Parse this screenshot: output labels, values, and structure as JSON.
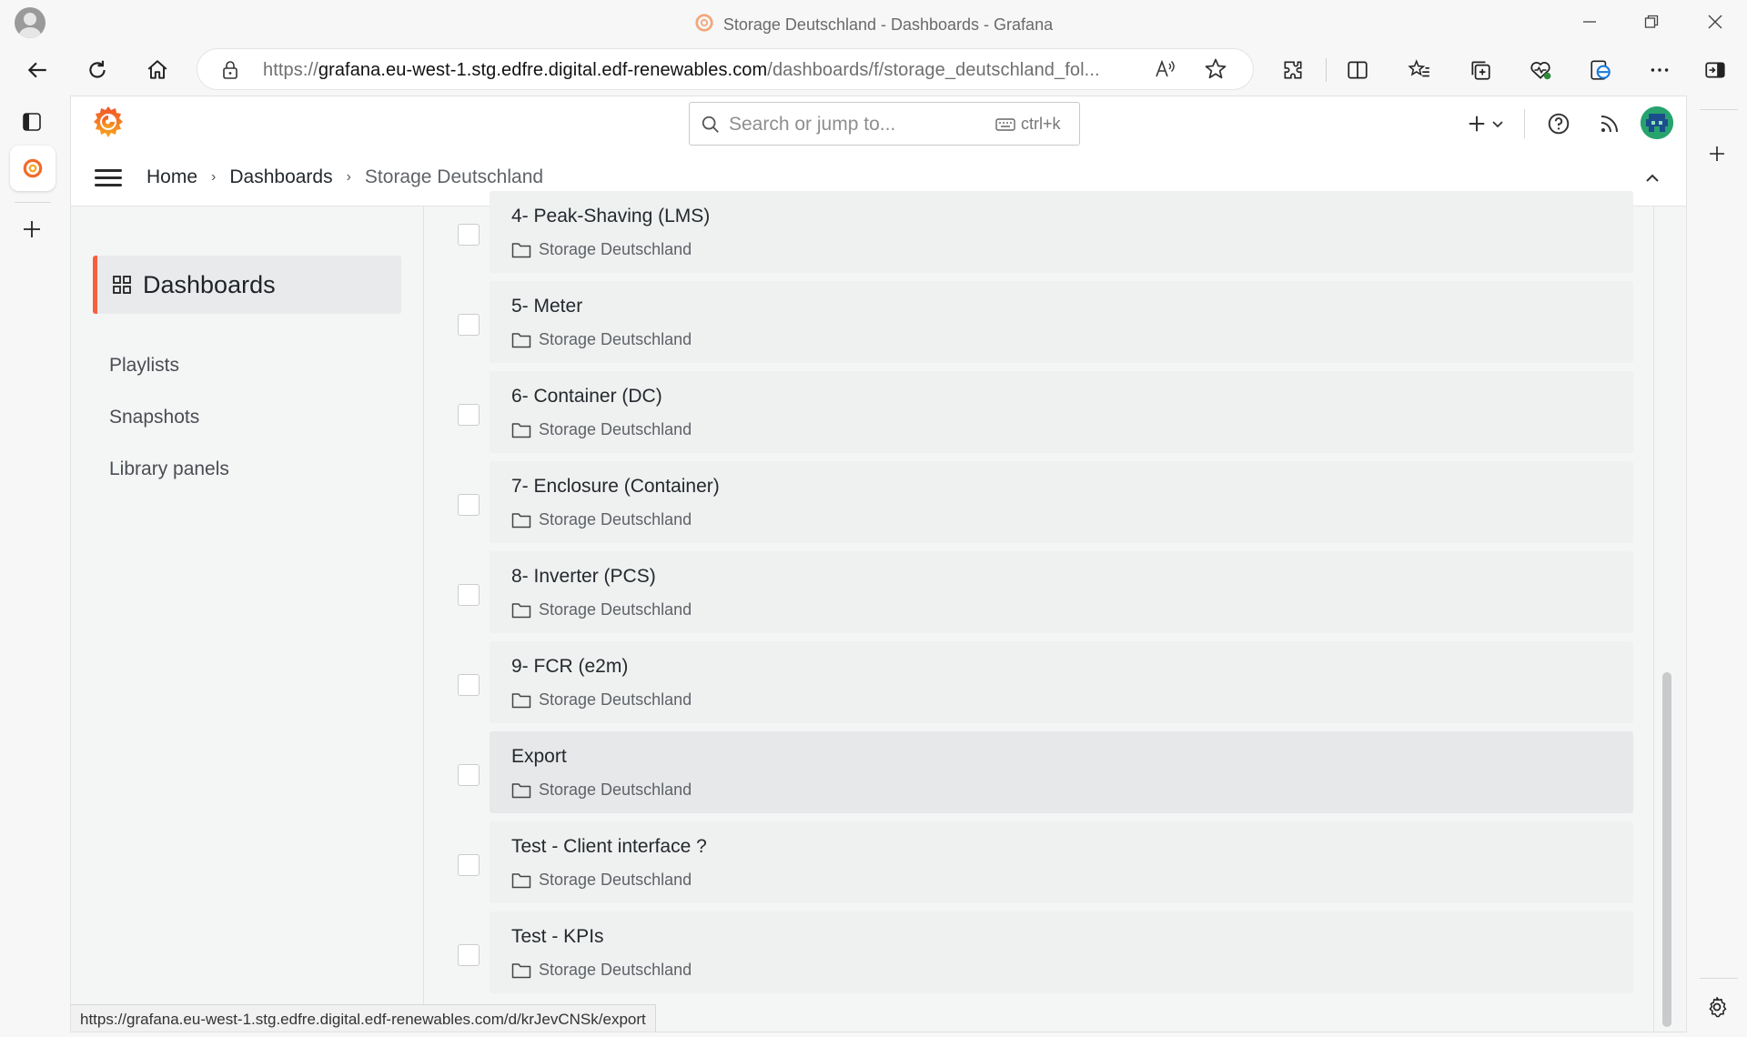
{
  "browser": {
    "window_title": "Storage Deutschland - Dashboards - Grafana",
    "url_origin": "https://",
    "url_host": "grafana.eu-west-1.stg.edfre.digital.edf-renewables.com",
    "url_path": "/dashboards/f/storage_deutschland_fol...",
    "status_url": "https://grafana.eu-west-1.stg.edfre.digital.edf-renewables.com/d/krJevCNSk/export"
  },
  "topbar": {
    "search_placeholder": "Search or jump to...",
    "search_shortcut": "ctrl+k"
  },
  "breadcrumb": {
    "items": [
      "Home",
      "Dashboards",
      "Storage Deutschland"
    ]
  },
  "sidebar": {
    "active": "Dashboards",
    "links": [
      "Playlists",
      "Snapshots",
      "Library panels"
    ]
  },
  "dashboards": [
    {
      "title": "4- Peak-Shaving (LMS)",
      "folder": "Storage Deutschland"
    },
    {
      "title": "5- Meter",
      "folder": "Storage Deutschland"
    },
    {
      "title": "6- Container (DC)",
      "folder": "Storage Deutschland"
    },
    {
      "title": "7- Enclosure (Container)",
      "folder": "Storage Deutschland"
    },
    {
      "title": "8- Inverter (PCS)",
      "folder": "Storage Deutschland"
    },
    {
      "title": "9- FCR (e2m)",
      "folder": "Storage Deutschland"
    },
    {
      "title": "Export",
      "folder": "Storage Deutschland"
    },
    {
      "title": "Test - Client interface ?",
      "folder": "Storage Deutschland"
    },
    {
      "title": "Test - KPIs",
      "folder": "Storage Deutschland"
    }
  ],
  "colors": {
    "accent": "#f55f3e",
    "card_bg": "#eff0f0",
    "card_hover_bg": "#e7e8e9"
  }
}
